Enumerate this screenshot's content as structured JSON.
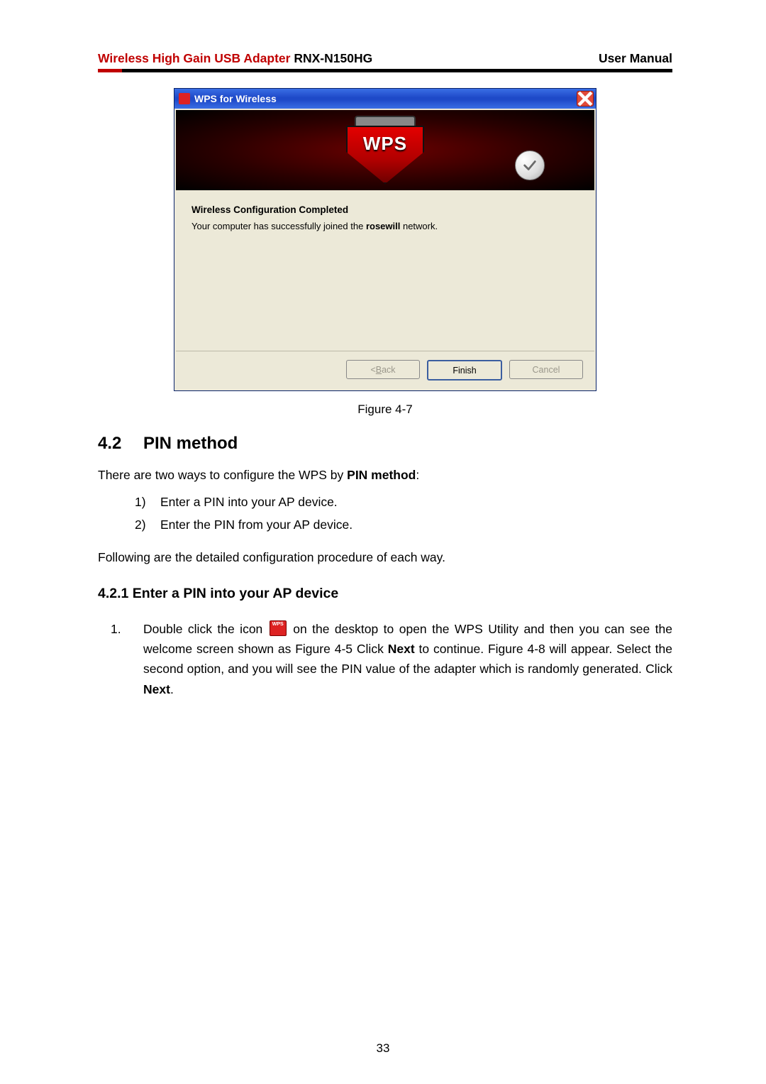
{
  "header": {
    "product_red": "Wireless High Gain USB Adapter",
    "product_model": " RNX-N150HG",
    "right": "User Manual"
  },
  "dialog": {
    "title": "WPS for Wireless",
    "shield_text": "WPS",
    "heading": "Wireless Configuration Completed",
    "msg_pre": "Your computer has successfully joined the ",
    "msg_net": "rosewill",
    "msg_post": " network.",
    "buttons": {
      "back": "< Back",
      "finish": "Finish",
      "cancel": "Cancel"
    }
  },
  "figure_caption": "Figure 4-7",
  "section42": {
    "num": "4.2",
    "title": "PIN method"
  },
  "intro_p_pre": "There are two ways to configure the WPS by ",
  "intro_p_bold": "PIN method",
  "intro_p_post": ":",
  "list": [
    {
      "n": "1)",
      "t": "Enter a PIN into your AP device."
    },
    {
      "n": "2)",
      "t": "Enter the PIN from your AP device."
    }
  ],
  "following_p": "Following are the detailed configuration procedure of each way.",
  "section421": "4.2.1  Enter a PIN into your AP device",
  "step1": {
    "n": "1.",
    "t1": "Double click the icon ",
    "t2": " on the desktop to open the WPS Utility and then you can see the welcome screen shown as Figure 4-5 Click ",
    "b1": "Next",
    "t3": " to continue. Figure 4-8 will appear. Select the second option, and you will see the PIN value of the adapter which is randomly generated. Click ",
    "b2": "Next",
    "t4": "."
  },
  "page_number": "33"
}
